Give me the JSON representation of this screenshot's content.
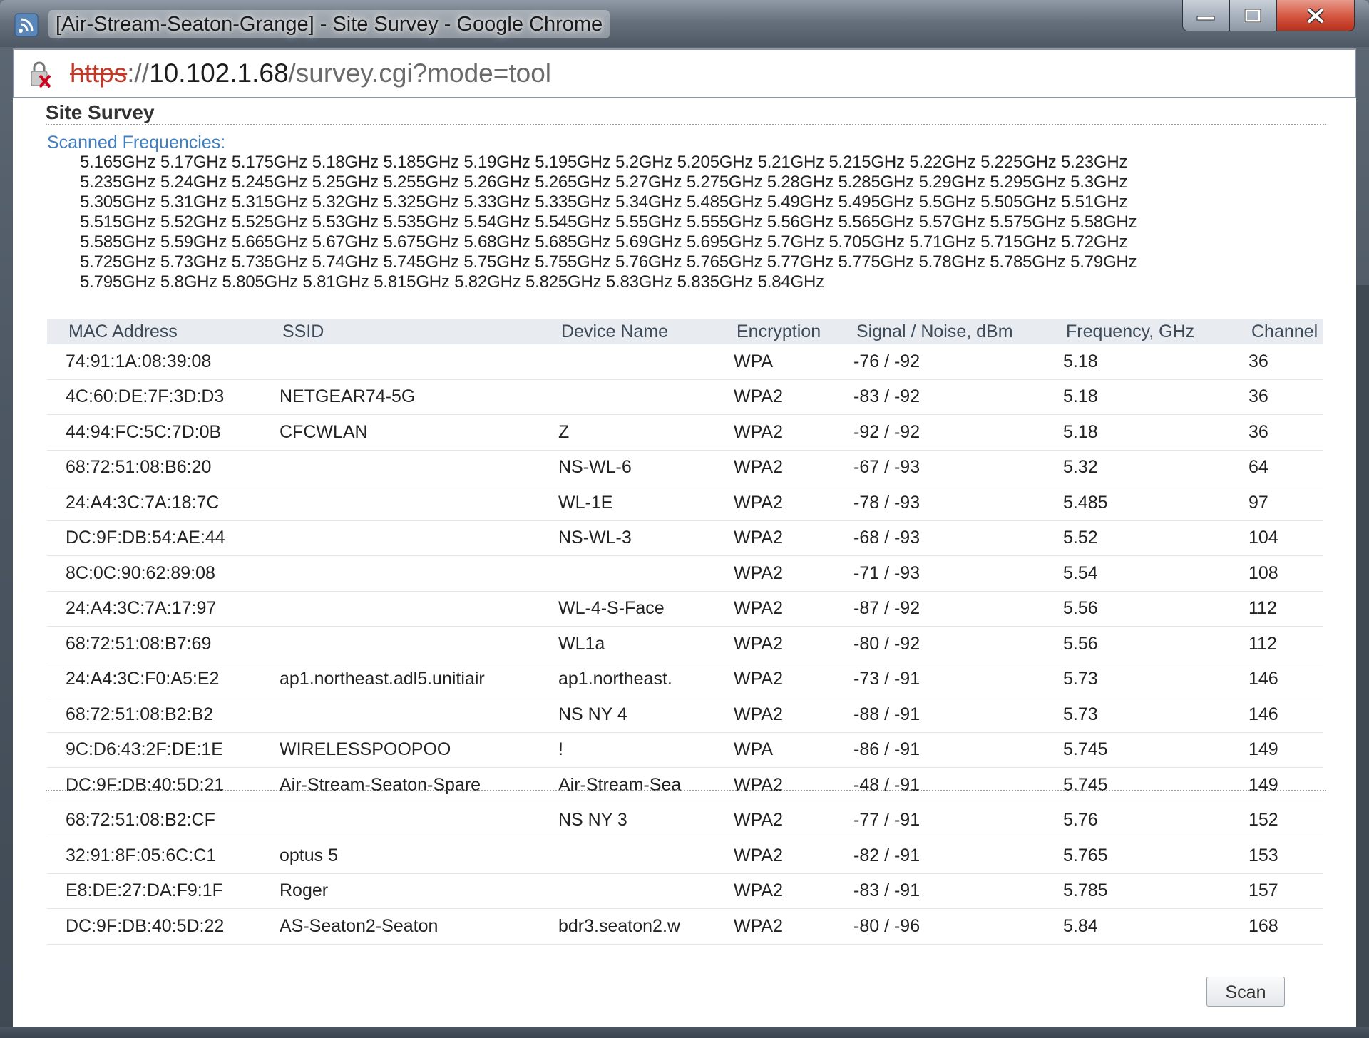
{
  "window": {
    "title": "[Air-Stream-Seaton-Grange] - Site Survey - Google Chrome",
    "icon": "wifi-signal-icon",
    "controls": [
      "minimize-icon",
      "maximize-icon",
      "close-icon"
    ]
  },
  "address_bar": {
    "scheme": "https",
    "separator": "://",
    "host": "10.102.1.68",
    "path": "/survey.cgi?mode=tool",
    "security_icon": "broken-lock-icon"
  },
  "page": {
    "title": "Site Survey",
    "scanned_label": "Scanned Frequencies:",
    "frequency_lines": [
      "5.165GHz 5.17GHz 5.175GHz 5.18GHz 5.185GHz 5.19GHz 5.195GHz 5.2GHz 5.205GHz 5.21GHz 5.215GHz 5.22GHz 5.225GHz 5.23GHz",
      "5.235GHz 5.24GHz 5.245GHz 5.25GHz 5.255GHz 5.26GHz 5.265GHz 5.27GHz 5.275GHz 5.28GHz 5.285GHz 5.29GHz 5.295GHz 5.3GHz",
      "5.305GHz 5.31GHz 5.315GHz 5.32GHz 5.325GHz 5.33GHz 5.335GHz 5.34GHz 5.485GHz 5.49GHz 5.495GHz 5.5GHz 5.505GHz 5.51GHz",
      "5.515GHz 5.52GHz 5.525GHz 5.53GHz 5.535GHz 5.54GHz 5.545GHz 5.55GHz 5.555GHz 5.56GHz 5.565GHz 5.57GHz 5.575GHz 5.58GHz",
      "5.585GHz 5.59GHz 5.665GHz 5.67GHz 5.675GHz 5.68GHz 5.685GHz 5.69GHz 5.695GHz 5.7GHz 5.705GHz 5.71GHz 5.715GHz 5.72GHz",
      "5.725GHz 5.73GHz 5.735GHz 5.74GHz 5.745GHz 5.75GHz 5.755GHz 5.76GHz 5.765GHz 5.77GHz 5.775GHz 5.78GHz 5.785GHz 5.79GHz",
      "5.795GHz 5.8GHz 5.805GHz 5.81GHz 5.815GHz 5.82GHz 5.825GHz 5.83GHz 5.835GHz 5.84GHz"
    ],
    "table": {
      "columns": [
        "MAC Address",
        "SSID",
        "Device Name",
        "Encryption",
        "Signal / Noise, dBm",
        "Frequency, GHz",
        "Channel"
      ],
      "rows": [
        [
          "74:91:1A:08:39:08",
          "",
          "",
          "WPA",
          "-76 / -92",
          "5.18",
          "36"
        ],
        [
          "4C:60:DE:7F:3D:D3",
          "NETGEAR74-5G",
          "",
          "WPA2",
          "-83 / -92",
          "5.18",
          "36"
        ],
        [
          "44:94:FC:5C:7D:0B",
          "CFCWLAN",
          "Z",
          "WPA2",
          "-92 / -92",
          "5.18",
          "36"
        ],
        [
          "68:72:51:08:B6:20",
          "",
          "NS-WL-6",
          "WPA2",
          "-67 / -93",
          "5.32",
          "64"
        ],
        [
          "24:A4:3C:7A:18:7C",
          "",
          "WL-1E",
          "WPA2",
          "-78 / -93",
          "5.485",
          "97"
        ],
        [
          "DC:9F:DB:54:AE:44",
          "",
          "NS-WL-3",
          "WPA2",
          "-68 / -93",
          "5.52",
          "104"
        ],
        [
          "8C:0C:90:62:89:08",
          "",
          "",
          "WPA2",
          "-71 / -93",
          "5.54",
          "108"
        ],
        [
          "24:A4:3C:7A:17:97",
          "",
          "WL-4-S-Face",
          "WPA2",
          "-87 / -92",
          "5.56",
          "112"
        ],
        [
          "68:72:51:08:B7:69",
          "",
          "WL1a",
          "WPA2",
          "-80 / -92",
          "5.56",
          "112"
        ],
        [
          "24:A4:3C:F0:A5:E2",
          "ap1.northeast.adl5.unitiair",
          "ap1.northeast.",
          "WPA2",
          "-73 / -91",
          "5.73",
          "146"
        ],
        [
          "68:72:51:08:B2:B2",
          "",
          "NS NY 4",
          "WPA2",
          "-88 / -91",
          "5.73",
          "146"
        ],
        [
          "9C:D6:43:2F:DE:1E",
          "WIRELESSPOOPOO",
          "!",
          "WPA",
          "-86 / -91",
          "5.745",
          "149"
        ],
        [
          "DC:9F:DB:40:5D:21",
          "Air-Stream-Seaton-Spare",
          "Air-Stream-Sea",
          "WPA2",
          "-48 / -91",
          "5.745",
          "149"
        ],
        [
          "68:72:51:08:B2:CF",
          "",
          "NS NY 3",
          "WPA2",
          "-77 / -91",
          "5.76",
          "152"
        ],
        [
          "32:91:8F:05:6C:C1",
          "optus 5",
          "",
          "WPA2",
          "-82 / -91",
          "5.765",
          "153"
        ],
        [
          "E8:DE:27:DA:F9:1F",
          "Roger",
          "",
          "WPA2",
          "-83 / -91",
          "5.785",
          "157"
        ],
        [
          "DC:9F:DB:40:5D:22",
          "AS-Seaton2-Seaton",
          "bdr3.seaton2.w",
          "WPA2",
          "-80 / -96",
          "5.84",
          "168"
        ]
      ]
    },
    "scan_button": "Scan"
  },
  "colors": {
    "label_blue": "#3f7fbf",
    "header_bg": "#e8ecf0",
    "insecure_scheme": "#c0392b"
  }
}
